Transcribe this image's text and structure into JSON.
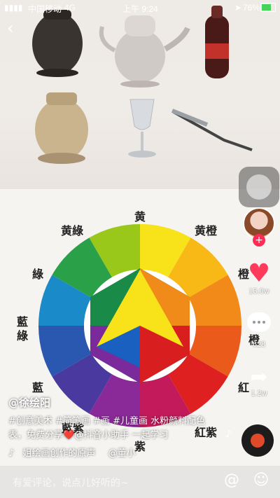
{
  "status_bar": {
    "carrier": "中国移动",
    "network": "4G",
    "time": "上午 9:24",
    "battery": "76%"
  },
  "wheel_labels": {
    "top": "黄",
    "yellow_green": "黄綠",
    "yellow_orange": "黄橙",
    "green": "綠",
    "orange": "橙",
    "blue_green": "藍綠",
    "orange_right": "橙",
    "blue": "藍",
    "red": "紅",
    "blue_purple": "藍紫",
    "purple": "紫",
    "red_purple": "紅紫"
  },
  "side_actions": {
    "like_count": "13.0w",
    "comment_count": "628",
    "share_count": "1.2w"
  },
  "caption": {
    "author": "@徐绘阳",
    "text_line1": "#创意美术 #简笔画 #画 #儿童画 水粉颜料配色",
    "text_line2": "表，免费分享❤️@抖音小助手 一起学习",
    "music": "姐绘画创作的原声",
    "music_author": "@董小"
  },
  "comment_bar": {
    "placeholder": "有爱评论，说点儿好听的~"
  },
  "colors": {
    "like": "#ff3b5c",
    "accent": "#fe2c55"
  }
}
